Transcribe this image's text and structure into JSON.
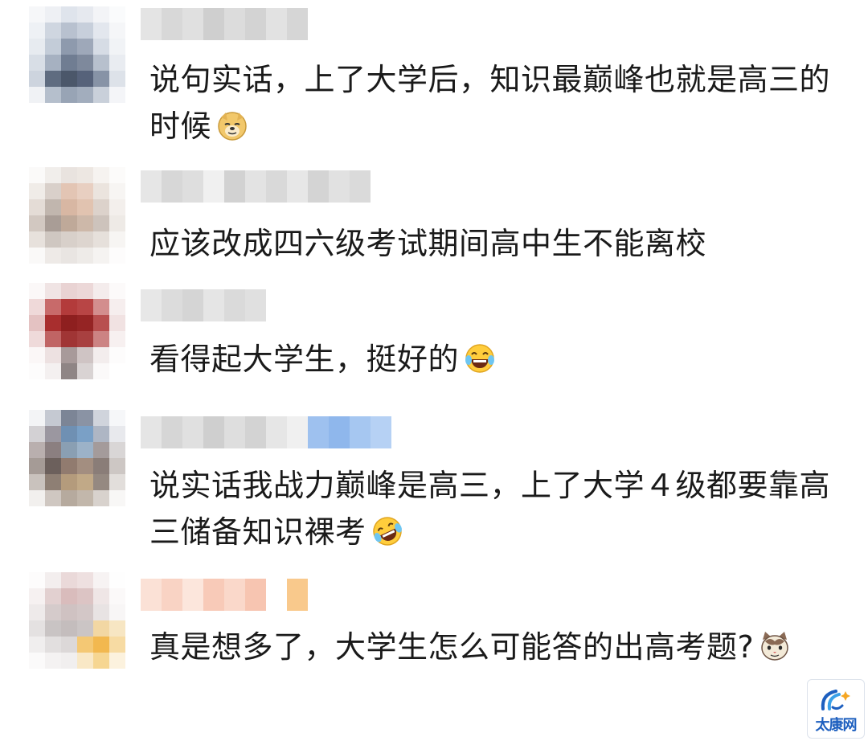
{
  "comments": [
    {
      "text": "说句实话，上了大学后，知识最巅峰也就是高三的时候",
      "emoji": "doge-emoji"
    },
    {
      "text": "应该改成四六级考试期间高中生不能离校",
      "emoji": ""
    },
    {
      "text": "看得起大学生，挺好的",
      "emoji": "laughing-tears-emoji"
    },
    {
      "text": "说实话我战力巅峰是高三，上了大学４级都要靠高三储备知识裸考",
      "emoji": "rofl-emoji"
    },
    {
      "text": "真是想多了，大学生怎么可能答的出高考题?",
      "emoji": "cat-face-emoji"
    }
  ],
  "watermark": {
    "text": "太康网"
  },
  "colors": {
    "text": "#1a1a1a",
    "watermark": "#1d5fbf"
  }
}
